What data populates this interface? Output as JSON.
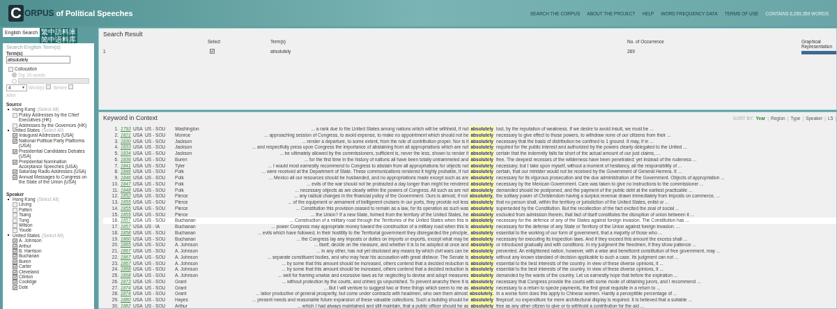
{
  "header": {
    "logo_letter": "C",
    "logo_rest": "ORPUS",
    "logo_tail": "of Political Speeches",
    "nav": [
      "SEARCH THE CORPUS",
      "ABOUT THE PROJECT",
      "HELP",
      "WORD FREQUENCY DATA",
      "TERMS OF USE"
    ],
    "word_count": "CONTAINS 6,269,359 WORDS"
  },
  "sidebar": {
    "tabs": [
      {
        "label": "English Search",
        "selected": true
      },
      {
        "label": "繁中語料庫",
        "selected": false
      },
      {
        "label": "简中语料库",
        "selected": false
      }
    ],
    "search_heading": "Search English Term(s)",
    "term_label": "Term(s)",
    "term_value": "absolutely",
    "collocation": {
      "label": "Collocation",
      "checked": false,
      "disabled": true,
      "top_label": "Top 20 words",
      "top_selected": true,
      "custom_selected": false,
      "window_value": "4",
      "window_arrow": "▼",
      "window_label": "Word(s)",
      "before_label": "Before",
      "before_checked": false,
      "after_label": "After",
      "after_checked": false
    },
    "source": {
      "title": "Source",
      "groups": [
        {
          "label": "Hong Kong",
          "select_all": "(Select All)",
          "items": [
            {
              "label": "Policy Addresses by the Chief Executives (HK)",
              "checked": false
            },
            {
              "label": "Addresses by the Governors (HK)",
              "checked": false
            }
          ]
        },
        {
          "label": "United States",
          "select_all": "(Select All)",
          "items": [
            {
              "label": "Inaugural Addresses (USA)",
              "checked": true
            },
            {
              "label": "National Political Party Platforms (USA)",
              "checked": true
            },
            {
              "label": "Presidential Candidates Debates (USA)",
              "checked": true
            },
            {
              "label": "Presidential Nomination Acceptance Speeches (USA)",
              "checked": true
            },
            {
              "label": "Saturday Radio Addresses (USA)",
              "checked": true
            },
            {
              "label": "Annual Messages to Congress on the State of the Union (USA)",
              "checked": true
            }
          ]
        }
      ]
    },
    "speaker": {
      "title": "Speaker",
      "groups": [
        {
          "label": "Hong Kong",
          "select_all": "(Select All)",
          "items": [
            {
              "label": "Leung",
              "checked": false
            },
            {
              "label": "Patten",
              "checked": false
            },
            {
              "label": "Tsang",
              "checked": false
            },
            {
              "label": "Tung",
              "checked": false
            },
            {
              "label": "Wilson",
              "checked": false
            },
            {
              "label": "Youde",
              "checked": false
            }
          ]
        },
        {
          "label": "United States",
          "select_all": "(Select All)",
          "items": [
            {
              "label": "A. Johnson",
              "checked": true
            },
            {
              "label": "Arthur",
              "checked": true
            },
            {
              "label": "B. Harrison",
              "checked": true
            },
            {
              "label": "Buchanan",
              "checked": true
            },
            {
              "label": "Buren",
              "checked": true
            },
            {
              "label": "Carter",
              "checked": true
            },
            {
              "label": "Cleveland",
              "checked": true
            },
            {
              "label": "Clinton",
              "checked": true
            },
            {
              "label": "Coolidge",
              "checked": true
            },
            {
              "label": "Dole",
              "checked": true
            }
          ]
        }
      ]
    }
  },
  "search_result": {
    "title": "Search Result",
    "columns": [
      "Select",
      "Term(s)",
      "No. of Occurrence",
      "Graphical Representation"
    ],
    "rows": [
      {
        "index": "1",
        "checked": true,
        "term": "absolutely",
        "occurrence": "289",
        "level": 1
      }
    ]
  },
  "kwic": {
    "title": "Keyword in Context",
    "sort_label": "SORT BY:",
    "separator": "|",
    "sort_options": [
      {
        "label": "Year",
        "selected": true
      },
      {
        "label": "Region",
        "selected": false
      },
      {
        "label": "Type",
        "selected": false
      },
      {
        "label": "Speaker",
        "selected": false
      },
      {
        "label": "L5",
        "selected": false
      }
    ],
    "rows": [
      {
        "number": "1.",
        "year": "1793",
        "region": "USA",
        "type": "US - SOU",
        "speaker": "Washington",
        "left": "... a rank due to the United States among nations which will be withheld, if not",
        "keyword": "absolutely",
        "right": "lost, by the reputation of weakness. If we desire to avoid insult, we must be ...",
        "selected": false
      },
      {
        "number": "2.",
        "year": "1821",
        "region": "USA",
        "type": "US - SOU",
        "speaker": "Monroe",
        "left": "... approaching session of Congress, to avoid expense, to make no appointment which should not be",
        "keyword": "absolutely",
        "right": "necessary to give effect to those powers, to withdraw none of our citizens from their ...",
        "selected": false
      },
      {
        "number": "3.",
        "year": "1830",
        "region": "USA",
        "type": "US - SOU",
        "speaker": "Jackson",
        "left": "... render a departure, to some extent, from the rule of contribution proper. Nor is it",
        "keyword": "absolutely",
        "right": "necessary that the basis of distribution be confined to 1 ground. It may, if in ...",
        "selected": false
      },
      {
        "number": "4.",
        "year": "1833",
        "region": "USA",
        "type": "US - SOU",
        "speaker": "Jackson",
        "left": "... and respectfully press upon Congress the importance of abstaining from all appropriations which are not",
        "keyword": "absolutely",
        "right": "required for the public interest and authorized by the powers clearly delegated to the United ...",
        "selected": false
      },
      {
        "number": "5.",
        "year": "1834",
        "region": "USA",
        "type": "US - SOU",
        "speaker": "Jackson",
        "left": "... be ultimately allowed by the commissioners, sufficient is, never the less, shown to render it",
        "keyword": "absolutely",
        "right": "certain that the indemnity falls far short of the actual amount of our just claims, ...",
        "selected": false
      },
      {
        "number": "6.",
        "year": "1836",
        "region": "USA",
        "type": "US - SOU",
        "speaker": "Buren",
        "left": "... for the first time in the history of nations all have been totally untrammeled and",
        "keyword": "absolutely",
        "right": "free. The deepest recesses of the wilderness have been penetrated; yet instead of the rudeness ...",
        "selected": false
      },
      {
        "number": "7.",
        "year": "1841",
        "region": "USA",
        "type": "US - SOU",
        "speaker": "Tyler",
        "left": "... I would most earnestly recommend to Congress to abstain from all appropriations for objects not",
        "keyword": "absolutely",
        "right": "necessary; but I take upon myself, without a moment of hesitancy, all the responsibility of ...",
        "selected": false
      },
      {
        "number": "8.",
        "year": "1846",
        "region": "USA",
        "type": "US - SOU",
        "speaker": "Polk",
        "left": "... were received at the Department of State. These communications rendered it highly probable, if not",
        "keyword": "absolutely",
        "right": "certain, that our minister would not be received by the Government of General Herrera. It ...",
        "selected": false
      },
      {
        "number": "9.",
        "year": "1846",
        "region": "USA",
        "type": "US - SOU",
        "speaker": "Polk",
        "left": "... Mexico all our resources should be husbanded, and no appropriations made except such as are",
        "keyword": "absolutely",
        "right": "necessary for its vigorous prosecution and the due administration of the Government. Objects of appropriation ...",
        "selected": false
      },
      {
        "number": "10.",
        "year": "1847",
        "region": "USA",
        "type": "US - SOU",
        "speaker": "Polk",
        "left": "... evils of the war should not be protracted a day longer than might be rendered",
        "keyword": "absolutely",
        "right": "necessary by the Mexican Government. Care was taken to give no instructions to the commissioner ...",
        "selected": false
      },
      {
        "number": "11.",
        "year": "1848",
        "region": "USA",
        "type": "US - SOU",
        "speaker": "Polk",
        "left": "... necessary objects as are clearly within the powers of Congress. All such as are not",
        "keyword": "absolutely",
        "right": "demanded should be postponed, and the payment of the public debt at the earliest practicable ...",
        "selected": false
      },
      {
        "number": "12.",
        "year": "1852",
        "region": "USA",
        "type": "US - SOU",
        "speaker": "Pierce",
        "left": "... any radical changes in the financial policy of the Government. Ours is almost, if not",
        "keyword": "absolutely,",
        "right": "the solitary power of Christendom having a surplus revenue drawn immediately from imposts on commerce, ...",
        "selected": false
      },
      {
        "number": "13.",
        "year": "1855",
        "region": "USA",
        "type": "US - SOU",
        "speaker": "Pierce",
        "left": "... of the equipment or armament of belligerent cruisers in our ports, they provide not less",
        "keyword": "absolutely",
        "right": "that no person shall, within the territory or jurisdiction of the United States, enlist or ...",
        "selected": false
      },
      {
        "number": "14.",
        "year": "1855",
        "region": "USA",
        "type": "US - SOU",
        "speaker": "Pierce",
        "left": "... Constitution this provision ceased to remain as a law, for its operation as such was",
        "keyword": "absolutely",
        "right": "superseded by the Constitution. But the recollection of the fact excited the zeal of social ...",
        "selected": false
      },
      {
        "number": "15.",
        "year": "1855",
        "region": "USA",
        "type": "US - SOU",
        "speaker": "Pierce",
        "left": "... the Union? If a new State, formed from the territory of the United States, be",
        "keyword": "absolutely",
        "right": "excluded from admission therein, that fact of itself constitutes the disruption of union between it ...",
        "selected": false
      },
      {
        "number": "16.",
        "year": "1857",
        "region": "USA",
        "type": "US - SOU",
        "speaker": "Buchanan",
        "left": "... Construction of a military road through the Territories of the United States when this is",
        "keyword": "absolutely",
        "right": "necessary for the defence of any of the States against foreign invasion. The Constitution has ...",
        "selected": true
      },
      {
        "number": "17.",
        "year": "1857",
        "region": "USA",
        "type": "US - IA",
        "speaker": "Buchanan",
        "left": "... power Congress may appropriate money toward the construction of a military road when this is",
        "keyword": "absolutely",
        "right": "necessary for the defense of any State or Territory of the Union against foreign invasion. ...",
        "selected": false
      },
      {
        "number": "18.",
        "year": "1858",
        "region": "USA",
        "type": "US - SOU",
        "speaker": "Buchanan",
        "left": "... evils which have followed, in their hostility to the Territorial government they disregarded the principle,",
        "keyword": "absolutely",
        "right": "essential to the working of our form of government, that a majority of those who ...",
        "selected": false
      },
      {
        "number": "19.",
        "year": "1860",
        "region": "USA",
        "type": "US - SOU",
        "speaker": "Buchanan",
        "left": "... the Congress lay any imposts or duties on imports or exports, except what may be",
        "keyword": "absolutely",
        "right": "necessary for executing its inspection laws. And if they exceed this amount the excess shall ...",
        "selected": false
      },
      {
        "number": "20.",
        "year": "1865",
        "region": "USA",
        "type": "US - SOU",
        "speaker": "A. Johnson",
        "left": "... itself, decide on the measure, and whether it is to be adopted at once and",
        "keyword": "absolutely",
        "right": "or introduced gradually and with conditions. In my judgment the freedmen, if they show patience ...",
        "selected": false
      },
      {
        "number": "21.",
        "year": "1867",
        "region": "USA",
        "type": "US - SOU",
        "speaker": "A. Johnson",
        "left": "... in any other, has not yet disclosed any means by which civil wars can be",
        "keyword": "absolutely",
        "right": "prevented. An enlightened nation, however, with a wise and beneficent constitution of free government, may ...",
        "selected": false
      },
      {
        "number": "22.",
        "year": "1867",
        "region": "USA",
        "type": "US - SOU",
        "speaker": "A. Johnson",
        "left": "... separate constituent bodies, and who may hear his accusation with great disfavor. The Senate is",
        "keyword": "absolutely",
        "right": "without any known standard of decision applicable to such a case. Its judgment can not ...",
        "selected": false
      },
      {
        "number": "23.",
        "year": "1867",
        "region": "USA",
        "type": "US - SOU",
        "speaker": "A. Johnson",
        "left": "... by some that this amount should be increased, others contend that a decided reduction is",
        "keyword": "absolutely",
        "right": "essential to the best interests of the country. In view of these diverse opinions, it ...",
        "selected": false
      },
      {
        "number": "24.",
        "year": "1868",
        "region": "USA",
        "type": "US - SOU",
        "speaker": "A. Johnson",
        "left": "... by some that this amount should be increased, others contend that a decided reduction is",
        "keyword": "absolutely",
        "right": "essential to the best interests of the country. In view of these diverse opinions, it ...",
        "selected": false
      },
      {
        "number": "25.",
        "year": "1868",
        "region": "USA",
        "type": "US - SOU",
        "speaker": "A. Johnson",
        "left": "... well for framing unwise and excessive laws as for neglecting to devise and adopt measures",
        "keyword": "absolutely",
        "right": "demanded by the wants of the country. Let us earnestly hope that before the expiration ...",
        "selected": false
      },
      {
        "number": "26.",
        "year": "1873",
        "region": "USA",
        "type": "US - SOU",
        "speaker": "Grant",
        "left": "... without protection by the courts, and crimes go unpunished. To prevent anarchy there it is",
        "keyword": "absolutely",
        "right": "necessary that Congress provide the courts with some mode of obtaining jurors, and I recommend ...",
        "selected": false
      },
      {
        "number": "27.",
        "year": "1874",
        "region": "USA",
        "type": "US - SOU",
        "speaker": "Grant",
        "left": "... But I will venture to suggest two or three things which seem to me as",
        "keyword": "absolutely",
        "right": "necessary to a return to specie payments, the first great requisite in a return to ...",
        "selected": false
      },
      {
        "number": "28.",
        "year": "1874",
        "region": "USA",
        "type": "US - SOU",
        "speaker": "Grant",
        "left": "... labor productive of general prosperity, but come under contracts with headmen, who own them almost",
        "keyword": "absolutely.",
        "right": "In a worse form does this apply to Chinese women. Hardly a perceptible percentage of ...",
        "selected": false
      },
      {
        "number": "29.",
        "year": "1880",
        "region": "USA",
        "type": "US - SOU",
        "speaker": "Hayes",
        "left": "... present needs and reasonable future expansion of these valuable collections. Such a building should be",
        "keyword": "absolutely",
        "right": "fireproof; no expenditure for mere architectural display is required. It is believed that a suitable ...",
        "selected": false
      },
      {
        "number": "30.",
        "year": "1882",
        "region": "USA",
        "type": "US - SOU",
        "speaker": "Arthur",
        "left": "... which I had always maintained and still maintain, that a public officer should be as",
        "keyword": "absolutely",
        "right": "free as any other citizen to give or to withhold a contribution for the aid ...",
        "selected": false
      }
    ]
  }
}
